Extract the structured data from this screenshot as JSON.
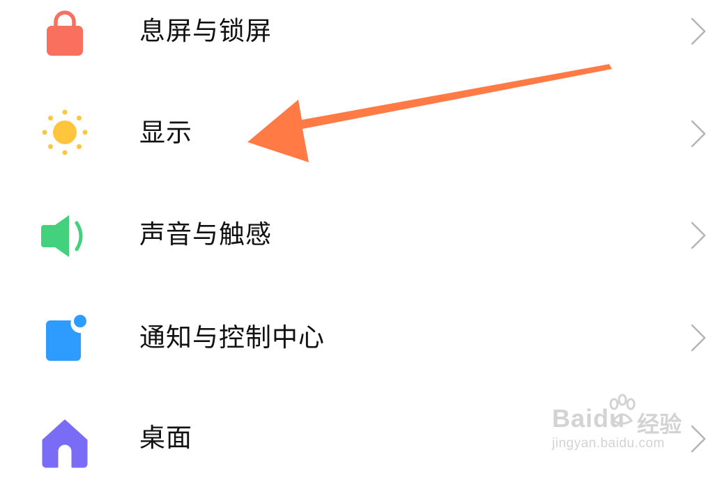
{
  "settings": {
    "items": [
      {
        "label": "息屏与锁屏",
        "icon": "lock-icon",
        "icon_color": "#F9705F"
      },
      {
        "label": "显示",
        "icon": "sun-icon",
        "icon_color": "#FFC53D"
      },
      {
        "label": "声音与触感",
        "icon": "speaker-icon",
        "icon_color": "#43D17D"
      },
      {
        "label": "通知与控制中心",
        "icon": "notification-icon",
        "icon_color": "#2E9CFF"
      },
      {
        "label": "桌面",
        "icon": "home-icon",
        "icon_color": "#7B6CF6"
      }
    ],
    "chevron_icon": "chevron-right-icon",
    "chevron_color": "#B5B5B5"
  },
  "annotation": {
    "type": "arrow",
    "points_to": "显示",
    "color": "#FF7A45"
  },
  "watermark": {
    "brand": "Baidu",
    "cn": "经验",
    "url": "jingyan.baidu.com"
  }
}
